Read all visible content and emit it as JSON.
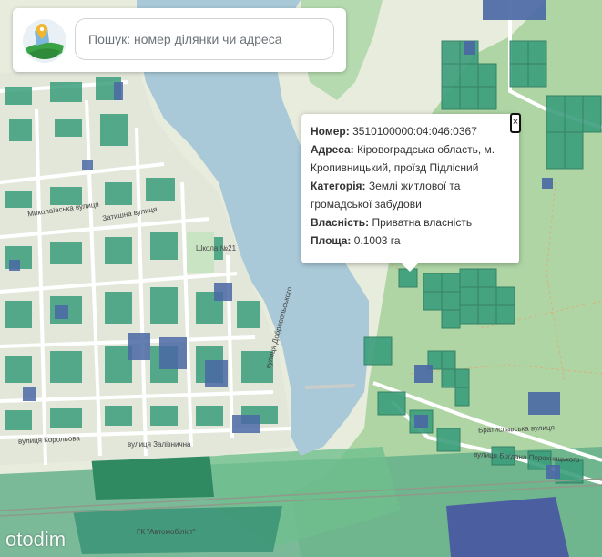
{
  "search": {
    "placeholder": "Пошук: номер ділянки чи адреса"
  },
  "popup": {
    "number_label": "Номер:",
    "number_value": "3510100000:04:046:0367",
    "address_label": "Адреса:",
    "address_value": "Кіровоградська область, м. Кропивницький, проїзд Підлісний",
    "category_label": "Категорія:",
    "category_value": "Землі житлової та громадської забудови",
    "ownership_label": "Власність:",
    "ownership_value": "Приватна власність",
    "area_label": "Площа:",
    "area_value": "0.1003 га",
    "close_symbol": "×"
  },
  "map": {
    "labels": {
      "school": "Школа №21",
      "street_zaliznychna": "вулиця Залізнична",
      "street_zatyshna": "Затишна вулиця",
      "street_bratyslavska": "Братиславська вулиця",
      "street_bogdana": "вулиця Богдана Порохницького",
      "street_dobrovolskoho": "вулиця Добровольського",
      "street_mykolaivska": "Миколаївська вулиця",
      "street_korolova": "вулиця Корольова",
      "gk": "ГК \"Автомобіліст\""
    },
    "colors": {
      "water": "#a9c9d8",
      "land": "#e8ecdd",
      "forest": "#8fc68e",
      "parcel_green": "#3b9e7c",
      "parcel_blue": "#4a68a5",
      "road": "#ffffff"
    }
  },
  "watermark": {
    "text": "otodim"
  }
}
